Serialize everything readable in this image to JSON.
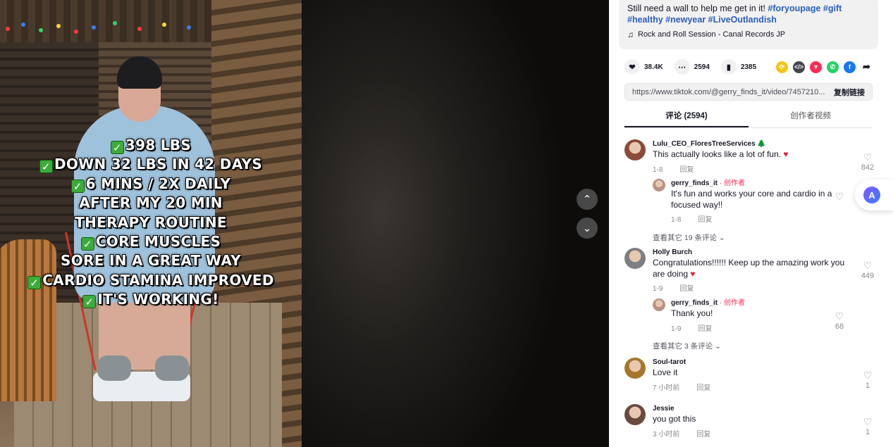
{
  "video": {
    "overlay_lines": [
      {
        "check": true,
        "text": "398 LBS"
      },
      {
        "check": true,
        "text": "DOWN 32 LBS IN 42 DAYS"
      },
      {
        "check": true,
        "text": "6 MINS / 2X DAILY"
      },
      {
        "check": false,
        "text": "AFTER MY 20 MIN"
      },
      {
        "check": false,
        "text": "THERAPY ROUTINE"
      },
      {
        "check": true,
        "text": "CORE MUSCLES"
      },
      {
        "check": false,
        "text": "SORE IN A GREAT WAY"
      },
      {
        "check": true,
        "text": "CARDIO STAMINA IMPROVED"
      },
      {
        "check": true,
        "text": "IT'S WORKING!"
      }
    ],
    "check_glyph": "✓",
    "nav_up_icon": "chevron-up-icon",
    "nav_down_icon": "chevron-down-icon"
  },
  "description": {
    "text": "Still need a wall to help me get in it! ",
    "hashtags": [
      "#foryoupage",
      "#gift",
      "#healthy",
      "#newyear",
      "#LiveOutlandish"
    ],
    "music": "Rock and Roll Session - Canal Records JP"
  },
  "stats": {
    "likes": "38.4K",
    "comments": "2594",
    "saves": "2385"
  },
  "link": {
    "url": "https://www.tiktok.com/@gerry_finds_it/video/7457210...",
    "copy_label": "复制链接"
  },
  "tabs": [
    {
      "label": "评论 (2594)",
      "active": true
    },
    {
      "label": "创作者视频",
      "active": false
    }
  ],
  "comments": [
    {
      "user": "Lulu_CEO_FloresTreeServices 🌲",
      "text": "This actually looks like a lot of fun.",
      "heart": true,
      "date": "1-8",
      "reply_label": "回复",
      "likes": "842",
      "avatar_color": "#8a4b3a",
      "reply": {
        "user": "gerry_finds_it",
        "author_tag": "· 创作者",
        "text": "It's fun and works your core and cardio in a focused way!!",
        "date": "1-8",
        "reply_label": "回复",
        "likes": "",
        "avatar_color": "#b89384"
      },
      "more": "查看其它 19 条评论 ⌄"
    },
    {
      "user": "Holly Burch",
      "text": "Congratulations!!!!!! Keep up the amazing work you are doing ",
      "heart": true,
      "date": "1-9",
      "reply_label": "回复",
      "likes": "449",
      "avatar_color": "#7d7f82",
      "reply": {
        "user": "gerry_finds_it",
        "author_tag": "· 创作者",
        "text": "Thank you!",
        "date": "1-9",
        "reply_label": "回复",
        "likes": "68",
        "avatar_color": "#b89384"
      },
      "more": "查看其它 3 条评论 ⌄"
    },
    {
      "user": "Soul-tarot",
      "text": "Love it",
      "heart": false,
      "date": "7 小时前",
      "reply_label": "回复",
      "likes": "1",
      "avatar_color": "#a5762c"
    },
    {
      "user": "Jessie",
      "text": "you got this",
      "heart": false,
      "date": "3 小时前",
      "reply_label": "回复",
      "likes": "1",
      "avatar_color": "#6b4b3f"
    }
  ],
  "colors": {
    "hashtag": "#2b5db9",
    "author": "#fe2c55",
    "heart": "#e01e3c",
    "check": "#3dab3b"
  },
  "share_icons": [
    {
      "name": "repost-icon",
      "color": "#f5c518",
      "glyph": "⟳"
    },
    {
      "name": "embed-icon",
      "color": "#43464f",
      "glyph": "</>"
    },
    {
      "name": "send-icon",
      "color": "#fe2c55",
      "glyph": "▼"
    },
    {
      "name": "whatsapp-icon",
      "color": "#25d366",
      "glyph": "✆"
    },
    {
      "name": "facebook-icon",
      "color": "#1877f2",
      "glyph": "f"
    },
    {
      "name": "share-arrow-icon",
      "color": "#ffffff",
      "glyph": "➦"
    }
  ]
}
